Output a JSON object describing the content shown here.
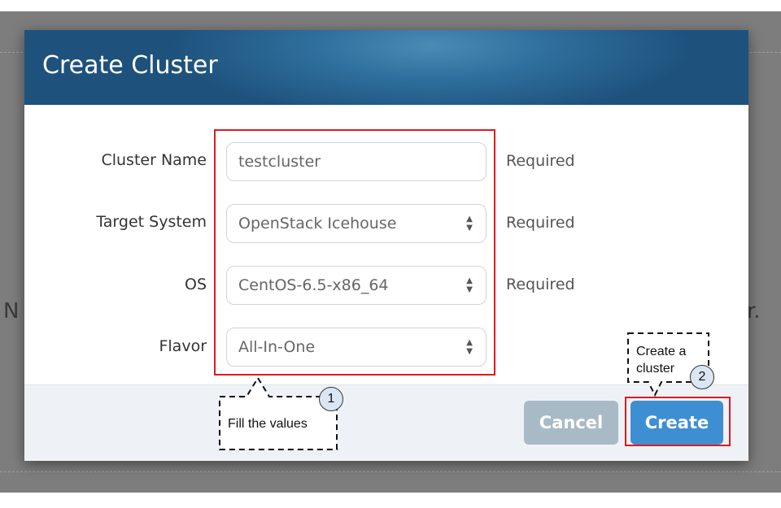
{
  "background": {
    "left_fragment": "N",
    "right_fragment": "r."
  },
  "modal": {
    "title": "Create Cluster",
    "fields": [
      {
        "label": "Cluster Name",
        "value": "testcluster",
        "required": "Required"
      },
      {
        "label": "Target System",
        "value": "OpenStack Icehouse",
        "required": "Required"
      },
      {
        "label": "OS",
        "value": "CentOS-6.5-x86_64",
        "required": "Required"
      },
      {
        "label": "Flavor",
        "value": "All-In-One",
        "required": ""
      }
    ],
    "cancel_label": "Cancel",
    "create_label": "Create"
  },
  "annotations": {
    "step1_number": "1",
    "step1_text": "Fill the values",
    "step2_number": "2",
    "step2_text": "Create a cluster"
  },
  "colors": {
    "header": "#2f6f9d",
    "highlight": "#e0191f",
    "create_button": "#3e8fd2",
    "cancel_button": "#a8bac6"
  }
}
